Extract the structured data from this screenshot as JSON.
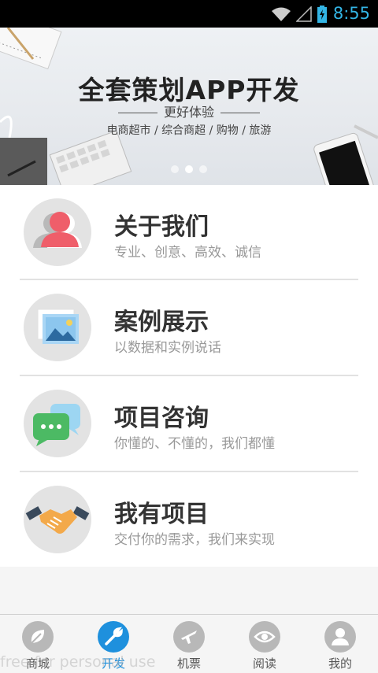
{
  "status": {
    "time": "8:55"
  },
  "banner": {
    "title": "全套策划APP开发",
    "subtitle": "更好体验",
    "tags": "电商超市 / 综合商超 / 购物 / 旅游"
  },
  "items": [
    {
      "title": "关于我们",
      "desc": "专业、创意、高效、诚信",
      "icon": "user-icon"
    },
    {
      "title": "案例展示",
      "desc": "以数据和实例说话",
      "icon": "picture-icon"
    },
    {
      "title": "项目咨询",
      "desc": "你懂的、不懂的，我们都懂",
      "icon": "chat-icon"
    },
    {
      "title": "我有项目",
      "desc": "交付你的需求，我们来实现",
      "icon": "handshake-icon"
    }
  ],
  "tabs": [
    {
      "label": "商城",
      "icon": "leaf-icon"
    },
    {
      "label": "开发",
      "icon": "wrench-icon",
      "active": true
    },
    {
      "label": "机票",
      "icon": "airplane-icon"
    },
    {
      "label": "阅读",
      "icon": "eye-icon"
    },
    {
      "label": "我的",
      "icon": "person-icon"
    }
  ],
  "watermark": "free for personal use",
  "colors": {
    "accent": "#1e90dd",
    "statusText": "#33b5e5"
  }
}
